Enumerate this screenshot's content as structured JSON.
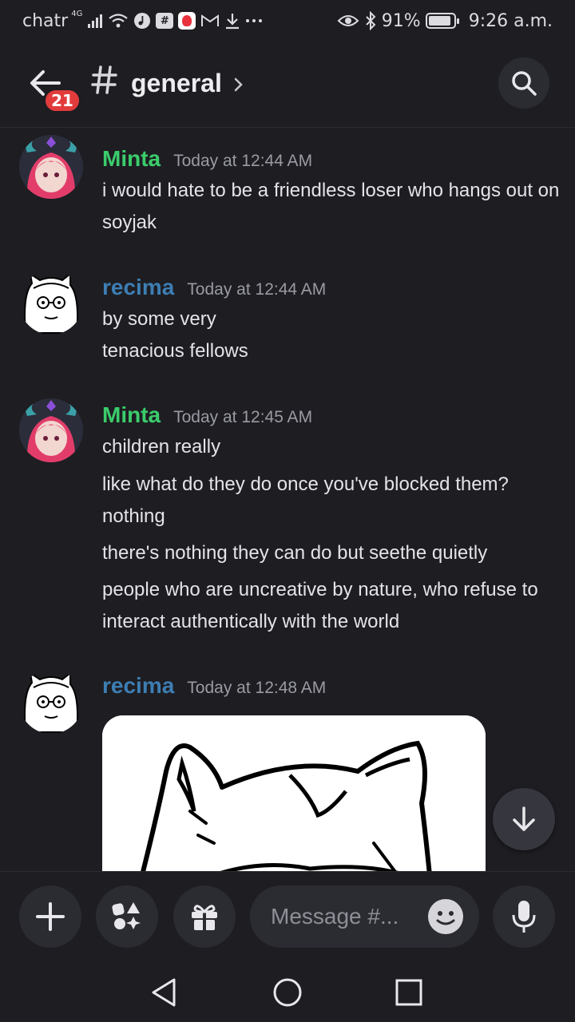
{
  "status_bar": {
    "carrier": "chatr",
    "network": "4G",
    "battery": "91%",
    "battery_level": 0.91,
    "time": "9:26 a.m.",
    "icons": [
      "signal-icon",
      "wifi-icon",
      "music-icon",
      "hash-notification-icon",
      "app-notification-icon",
      "gmail-icon",
      "download-icon",
      "more-icon",
      "eye-icon",
      "bluetooth-icon",
      "battery-icon"
    ]
  },
  "header": {
    "unread_count": "21",
    "channel_name": "general"
  },
  "messages": [
    {
      "author": "Minta",
      "timestamp": "Today at 12:44 AM",
      "lines": [
        "i would hate to be a friendless loser who hangs out on soyjak"
      ],
      "author_color": "#3bcc6b"
    },
    {
      "author": "recima",
      "timestamp": "Today at 12:44 AM",
      "lines": [
        "by some very",
        "tenacious fellows"
      ],
      "author_color": "#3d7eb3"
    },
    {
      "author": "Minta",
      "timestamp": "Today at 12:45 AM",
      "lines": [
        "children really",
        "like what do they do once you've blocked them? nothing",
        "there's nothing they can do but seethe quietly",
        "people who are uncreative by nature, who refuse to interact authentically with the world"
      ],
      "author_color": "#3bcc6b"
    },
    {
      "author": "recima",
      "timestamp": "Today at 12:48 AM",
      "lines": [],
      "has_image": true,
      "author_color": "#3d7eb3"
    }
  ],
  "composer": {
    "placeholder": "Message #..."
  },
  "colors": {
    "background": "#1d1d22",
    "surface": "#2b2c32",
    "badge": "#e23b3b"
  }
}
